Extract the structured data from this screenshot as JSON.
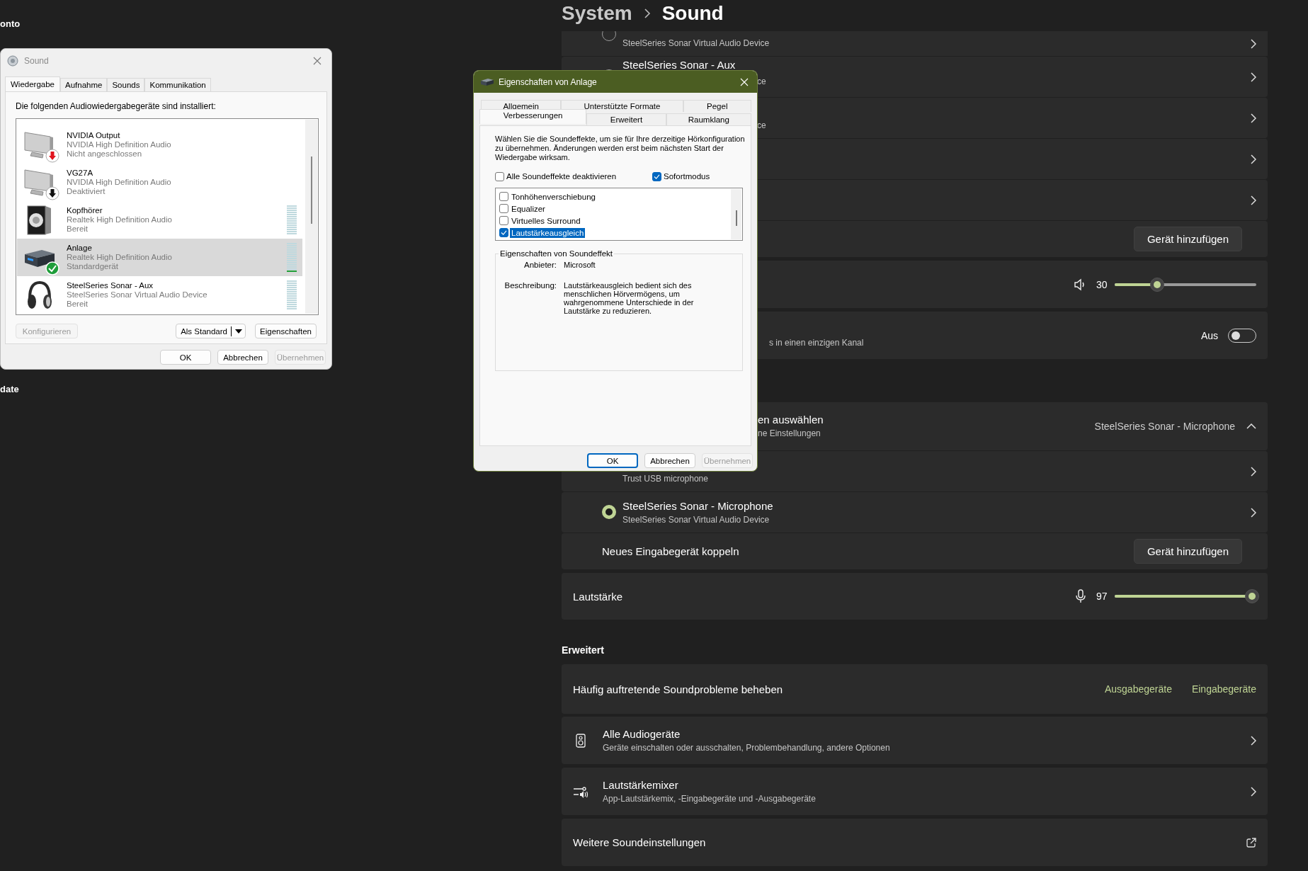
{
  "desktop": {
    "fragments": [
      "onto",
      "date"
    ]
  },
  "settings": {
    "breadcrumb": {
      "parent": "System",
      "current": "Sound"
    },
    "output_devices": [
      {
        "kind": "device",
        "subtitle": "SteelSeries Sonar Virtual Audio Device",
        "selected": false
      },
      {
        "kind": "device",
        "title": "SteelSeries Sonar - Aux",
        "subtitle_tail": "ce",
        "selected": false
      },
      {
        "kind": "device",
        "subtitle_tail": "ce"
      },
      {
        "kind": "device"
      },
      {
        "kind": "device"
      },
      {
        "kind": "pair",
        "button": "Gerät hinzufügen"
      }
    ],
    "output_volume": {
      "value": "30",
      "level": 0.3
    },
    "mono_audio": {
      "subtitle_tail": "s in einen einzigen Kanal",
      "state_label": "Aus",
      "on": false
    },
    "input_select": {
      "title_tail": "en auswählen",
      "subtitle_tail": "ne Einstellungen",
      "value": "SteelSeries Sonar - Microphone",
      "expanded": true
    },
    "input_devices": [
      {
        "kind": "device",
        "subtitle": "Trust USB microphone"
      },
      {
        "kind": "device",
        "title": "SteelSeries Sonar - Microphone",
        "subtitle": "SteelSeries Sonar Virtual Audio Device",
        "selected": true
      },
      {
        "kind": "pair",
        "title": "Neues Eingabegerät koppeln",
        "button": "Gerät hinzufügen"
      }
    ],
    "input_volume": {
      "label": "Lautstärke",
      "value": "97",
      "level": 0.97
    },
    "advanced": {
      "heading": "Erweitert",
      "troubleshoot": {
        "label": "Häufig auftretende Soundprobleme beheben",
        "links": [
          "Ausgabegeräte",
          "Eingabegeräte"
        ]
      },
      "items": [
        {
          "kind": "devices",
          "title": "Alle Audiogeräte",
          "subtitle": "Geräte einschalten oder ausschalten, Problembehandlung, andere Optionen"
        },
        {
          "kind": "mixer",
          "title": "Lautstärkemixer",
          "subtitle": "App-Lautstärkemix, -Eingabegeräte und -Ausgabegeräte"
        },
        {
          "kind": "external",
          "title": "Weitere Soundeinstellungen"
        }
      ]
    }
  },
  "sound_dialog": {
    "title": "Sound",
    "tabs": [
      {
        "label": "Wiedergabe",
        "selected": true
      },
      {
        "label": "Aufnahme",
        "selected": false
      },
      {
        "label": "Sounds",
        "selected": false
      },
      {
        "label": "Kommunikation",
        "selected": false
      }
    ],
    "heading": "Die folgenden Audiowiedergabegeräte sind installiert:",
    "devices": [
      {
        "kind": "display",
        "name": "NVIDIA Output",
        "driver": "NVIDIA High Definition Audio",
        "status": "Nicht angeschlossen",
        "badge": {
          "kind": "unplugged"
        },
        "selected": false
      },
      {
        "kind": "display",
        "name": "VG27A",
        "driver": "NVIDIA High Definition Audio",
        "status": "Deaktiviert",
        "badge": {
          "kind": "disabled"
        },
        "selected": false
      },
      {
        "kind": "speaker",
        "name": "Kopfhörer",
        "driver": "Realtek High Definition Audio",
        "status": "Bereit",
        "selected": false,
        "meter": true
      },
      {
        "kind": "receiver",
        "name": "Anlage",
        "driver": "Realtek High Definition Audio",
        "status": "Standardgerät",
        "badge": {
          "kind": "default"
        },
        "selected": true,
        "meter": true,
        "level": 0.07
      },
      {
        "kind": "headset",
        "name": "SteelSeries Sonar - Aux",
        "driver": "SteelSeries Sonar Virtual Audio Device",
        "status": "Bereit",
        "selected": false,
        "meter": true
      }
    ],
    "buttons": [
      {
        "label": "Konfigurieren",
        "kind": "plain",
        "disabled": true
      },
      {
        "label": "Als Standard",
        "kind": "split",
        "disabled": false
      },
      {
        "label": "Eigenschaften",
        "kind": "plain",
        "disabled": false
      }
    ],
    "footer_buttons": [
      {
        "label": "OK",
        "default": false,
        "disabled": false
      },
      {
        "label": "Abbrechen",
        "default": false,
        "disabled": false
      },
      {
        "label": "Übernehmen",
        "default": false,
        "disabled": true
      }
    ]
  },
  "properties_dialog": {
    "title": "Eigenschaften von Anlage",
    "tab_rows": [
      {
        "tabs": [
          {
            "label": "Allgemein",
            "selected": false
          },
          {
            "label": "Unterstützte Formate",
            "selected": false
          },
          {
            "label": "Pegel",
            "selected": false
          }
        ]
      },
      {
        "tabs": [
          {
            "label": "Verbesserungen",
            "selected": true
          },
          {
            "label": "Erweitert",
            "selected": false
          },
          {
            "label": "Raumklang",
            "selected": false
          }
        ]
      }
    ],
    "intro": "Wählen Sie die Soundeffekte, um sie für Ihre derzeitige Hörkonfiguration zu übernehmen. Änderungen werden erst beim nächsten Start der Wiedergabe wirksam.",
    "options": [
      {
        "label": "Alle Soundeffekte deaktivieren",
        "checked": false
      },
      {
        "label": "Sofortmodus",
        "checked": true
      }
    ],
    "effects": [
      {
        "label": "Tonhöhenverschiebung",
        "checked": false,
        "selected": false
      },
      {
        "label": "Equalizer",
        "checked": false,
        "selected": false
      },
      {
        "label": "Virtuelles Surround",
        "checked": false,
        "selected": false
      },
      {
        "label": "Lautstärkeausgleich",
        "checked": true,
        "selected": true
      }
    ],
    "group": {
      "title": "Eigenschaften von Soundeffekt",
      "fields": [
        {
          "label": "Anbieter:",
          "value": "Microsoft"
        },
        {
          "label": "Beschreibung:",
          "value": "Lautstärkeausgleich bedient sich des menschlichen Hörvermögens, um wahrgenommene Unterschiede in der Lautstärke zu reduzieren."
        }
      ]
    },
    "buttons": [
      {
        "label": "OK",
        "default": true,
        "disabled": false
      },
      {
        "label": "Abbrechen",
        "default": false,
        "disabled": false
      },
      {
        "label": "Übernehmen",
        "default": false,
        "disabled": true
      }
    ]
  }
}
